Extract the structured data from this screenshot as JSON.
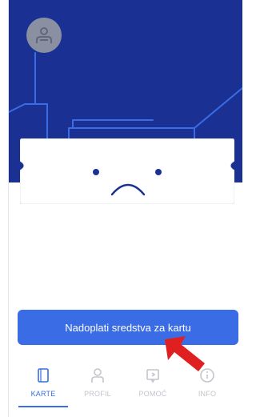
{
  "colors": {
    "header_bg": "#1a3193",
    "accent": "#3a6ce6",
    "ticket_bg": "#ffffff",
    "inactive_tab": "#c2c5cc",
    "annotation_arrow": "#e02020"
  },
  "avatar": {
    "icon": "person-icon"
  },
  "ticket": {
    "face": "sad-face"
  },
  "cta": {
    "label": "Nadoplati sredstva za kartu"
  },
  "tabs": [
    {
      "label": "KARTE",
      "icon": "card-icon",
      "active": true
    },
    {
      "label": "PROFIL",
      "icon": "person-icon",
      "active": false
    },
    {
      "label": "POMOĆ",
      "icon": "help-icon",
      "active": false
    },
    {
      "label": "INFO",
      "icon": "info-icon",
      "active": false
    }
  ]
}
